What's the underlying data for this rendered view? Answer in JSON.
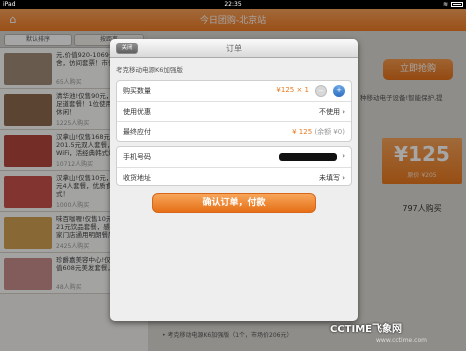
{
  "status_bar": {
    "carrier": "iPad",
    "wifi": "≋",
    "time": "22:35",
    "battery": ""
  },
  "navbar": {
    "title": "今日团购-北京站"
  },
  "tabs": [
    {
      "label": "默认排序"
    },
    {
      "label": "按距离"
    }
  ],
  "list": [
    {
      "text": "元,价值920-1069元的恒美舍，仿间套票！市值和服...",
      "buyers": "65人购买",
      "color": "#a08c78"
    },
    {
      "text": "清华池!仅售90元，价值220元足道套餐！1位使用，专业养生休闲！",
      "buyers": "1225人购买",
      "color": "#8c6a4e"
    },
    {
      "text": "汉拿山!仅售168元，价值201.5元双人套餐，提供免费WiFi，活经典韩式烤肉！",
      "buyers": "10712人购买",
      "color": "#b4463c"
    },
    {
      "text": "汉拿山!仅售10元，价值32.2元4人套餐，优质食材品味韩式！",
      "buyers": "1000人购买",
      "color": "#c8504a"
    },
    {
      "text": "味百咖喱!仅售10元，价值18-21元饮品套餐，感受清新，多家门店通用明朗餐厅！",
      "buyers": "2425人购买",
      "color": "#d2a050"
    },
    {
      "text": "珍爵嘉美容中心!仅售59元，价值608元美发套餐，...",
      "buyers": "48人购买",
      "color": "#c88c8c"
    }
  ],
  "detail": {
    "buy_button": "立即抢购",
    "description": "种移动电子设备!智能保护,提",
    "price": "¥125",
    "original_price": "原价 ¥205",
    "buyers": "797人购买",
    "bottom_text": "• 考克移动电源K6加强版（1个，市场价206元）"
  },
  "watermark": {
    "main": "CCTIME飞象网",
    "sub": "www.cctime.com"
  },
  "modal": {
    "title": "订单",
    "close_label": "关闭",
    "product_name": "考克移动电源K6加强版",
    "rows1": [
      {
        "label": "购买数量",
        "value": "¥125 × 1"
      },
      {
        "label": "使用优惠",
        "value": "不使用 ›"
      },
      {
        "label": "最终应付",
        "value": "¥ 125",
        "note": "(余额 ¥0)"
      }
    ],
    "rows2": [
      {
        "label": "手机号码",
        "value": ""
      },
      {
        "label": "收货地址",
        "value": "未填写 ›"
      }
    ],
    "minus": "−",
    "plus": "+",
    "confirm_label": "确认订单，付款"
  },
  "colors": {
    "accent": "#e8781e",
    "navbar": "#f08a35",
    "blue": "#2e6fc0"
  }
}
